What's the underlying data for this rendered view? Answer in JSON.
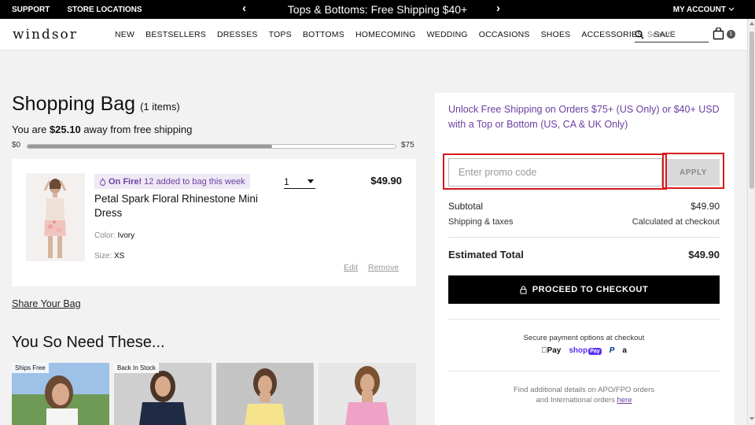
{
  "topbar": {
    "support": "SUPPORT",
    "store_locations": "STORE LOCATIONS",
    "promo": "Tops & Bottoms: Free Shipping $40+",
    "prev_arrow": "‹",
    "next_arrow": "›",
    "my_account": "MY ACCOUNT"
  },
  "header": {
    "logo": "windsor",
    "nav": [
      "NEW",
      "BESTSELLERS",
      "DRESSES",
      "TOPS",
      "BOTTOMS",
      "HOMECOMING",
      "WEDDING",
      "OCCASIONS",
      "SHOES",
      "ACCESSORIES",
      "SALE"
    ],
    "search_placeholder": "Search",
    "bag_count": "1"
  },
  "bag": {
    "title": "Shopping Bag",
    "item_count": "(1 items)",
    "away_prefix": "You are ",
    "away_amount": "$25.10",
    "away_suffix": " away from free shipping",
    "progress_min": "$0",
    "progress_max": "$75",
    "progress_fraction": 0.665
  },
  "item": {
    "badge_strong": "On Fire!",
    "badge_text": "12 added to bag this week",
    "name": "Petal Spark Floral Rhinestone Mini Dress",
    "color_label": "Color:",
    "color_value": "Ivory",
    "size_label": "Size:",
    "size_value": "XS",
    "qty": "1",
    "price": "$49.90",
    "edit": "Edit",
    "remove": "Remove"
  },
  "share_bag": "Share Your Bag",
  "recommendations": {
    "title": "You So Need These...",
    "tags": [
      "Ships Free",
      "Back In Stock",
      "",
      ""
    ]
  },
  "summary": {
    "unlock": "Unlock Free Shipping on Orders $75+ (US Only) or $40+ USD with a Top or Bottom (US, CA & UK Only)",
    "promo_placeholder": "Enter promo code",
    "apply": "APPLY",
    "subtotal_label": "Subtotal",
    "subtotal_value": "$49.90",
    "shipping_label": "Shipping & taxes",
    "shipping_value": "Calculated at checkout",
    "total_label": "Estimated Total",
    "total_value": "$49.90",
    "checkout": "PROCEED TO CHECKOUT",
    "secure": "Secure payment options at checkout",
    "pay_apple": "Pay",
    "pay_shop": "shop",
    "pay_shop_pill": "Pay",
    "pay_paypal": "P",
    "pay_amazon": "a",
    "apo_line1": "Find additional details on APO/FPO orders",
    "apo_line2": "and International orders ",
    "apo_here": "here"
  },
  "colors": {
    "accent_purple": "#6b3fa0",
    "highlight_red": "#d61a1a",
    "checkout_bg": "#000000"
  }
}
